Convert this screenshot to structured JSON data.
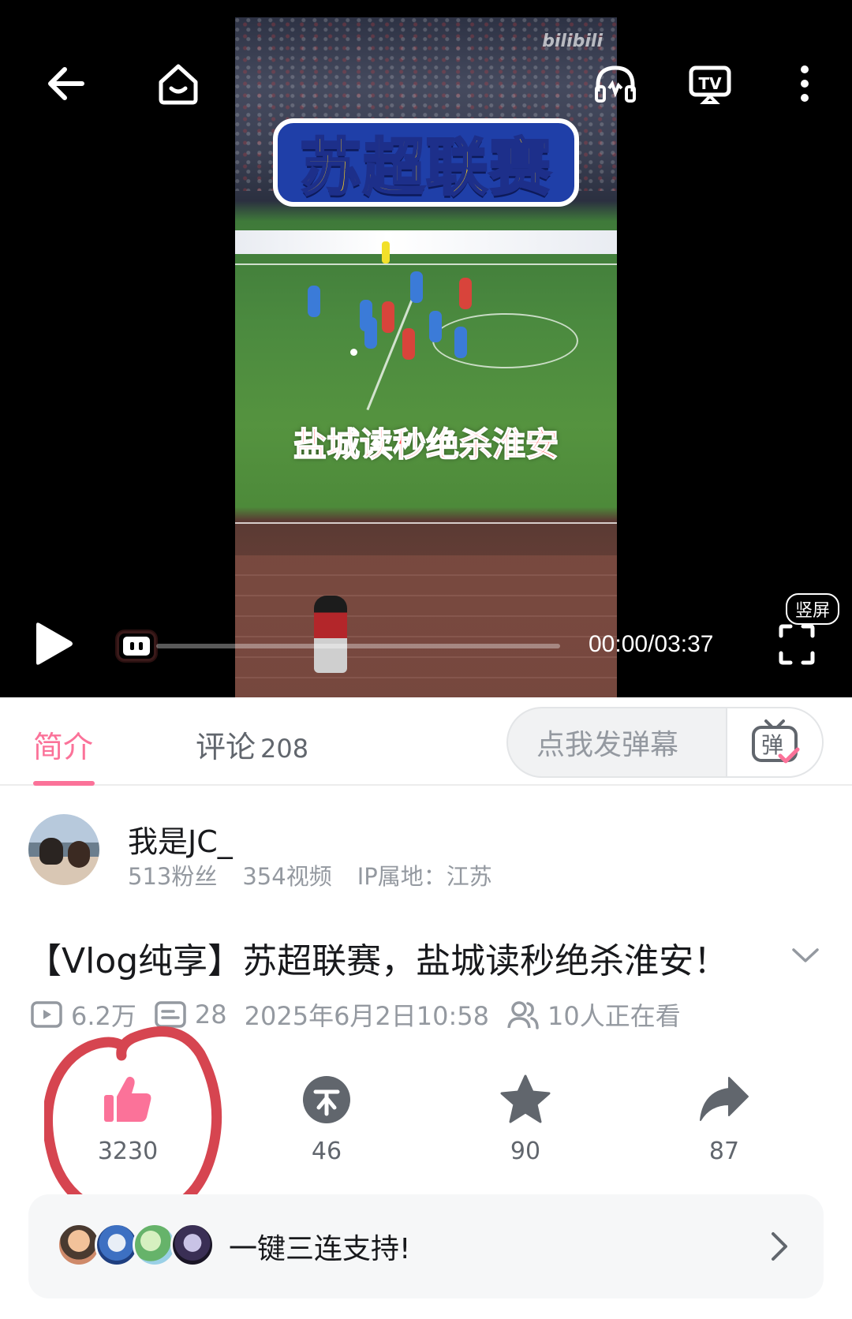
{
  "player": {
    "overlay_title": "苏超联赛",
    "overlay_caption": "盐城读秒绝杀淮安",
    "watermark": "bilibili",
    "time": "00:00/03:37",
    "progress": 0.0,
    "vertical_badge": "竖屏",
    "icons": {
      "back": "back-arrow-icon",
      "home": "home-icon",
      "listen": "headphones-icon",
      "cast": "tv-cast-icon",
      "more": "more-vertical-icon",
      "play": "play-icon",
      "danmaku_toggle": "danmaku-toggle-icon",
      "fullscreen": "fullscreen-icon"
    }
  },
  "tabs": {
    "intro": "简介",
    "comments": "评论",
    "comments_count": "208",
    "danmaku_placeholder": "点我发弹幕",
    "danmaku_button": "弹"
  },
  "uploader": {
    "name": "我是JC_",
    "followers": "513粉丝",
    "videos": "354视频",
    "ip": "IP属地：江苏"
  },
  "video": {
    "title": "【Vlog纯享】苏超联赛，盐城读秒绝杀淮安！",
    "views": "6.2万",
    "danmaku_count": "28",
    "date": "2025年6月2日10:58",
    "watching": "10人正在看"
  },
  "actions": {
    "likes": "3230",
    "coins": "46",
    "favorites": "90",
    "shares": "87"
  },
  "triple": {
    "label": "一键三连支持!"
  },
  "colors": {
    "accent": "#fb7299",
    "text_secondary": "#9499a0",
    "icon_gray": "#61666d",
    "annotation_red": "#d64550"
  }
}
